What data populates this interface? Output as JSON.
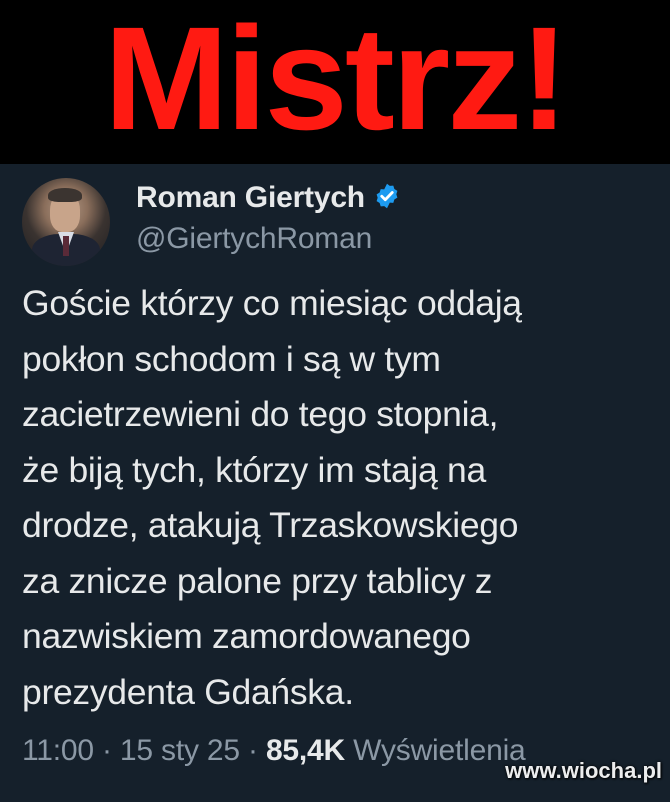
{
  "banner": {
    "title": "Mistrz!",
    "color": "#ff1a12"
  },
  "tweet": {
    "author": {
      "display_name": "Roman Giertych",
      "handle": "@GiertychRoman",
      "verified_icon": "verified-badge-icon",
      "verified_color": "#1d9bf0"
    },
    "text": "Goście którzy co miesiąc oddają\npokłon schodom i są w tym\nzacietrzewieni do tego stopnia,\nże biją tych, którzy im stają na\ndrodze, atakują Trzaskowskiego\nza znicze palone przy tablicy z\nnazwiskiem zamordowanego\nprezydenta Gdańska.",
    "time": "11:00",
    "separator": " · ",
    "date": "15 sty 25",
    "views_count": "85,4K",
    "views_label": "Wyświetlenia"
  },
  "watermark": "www.wiocha.pl",
  "colors": {
    "tweet_background": "#15202b",
    "text_primary": "#e7e9ea",
    "text_secondary": "#8b98a5"
  }
}
